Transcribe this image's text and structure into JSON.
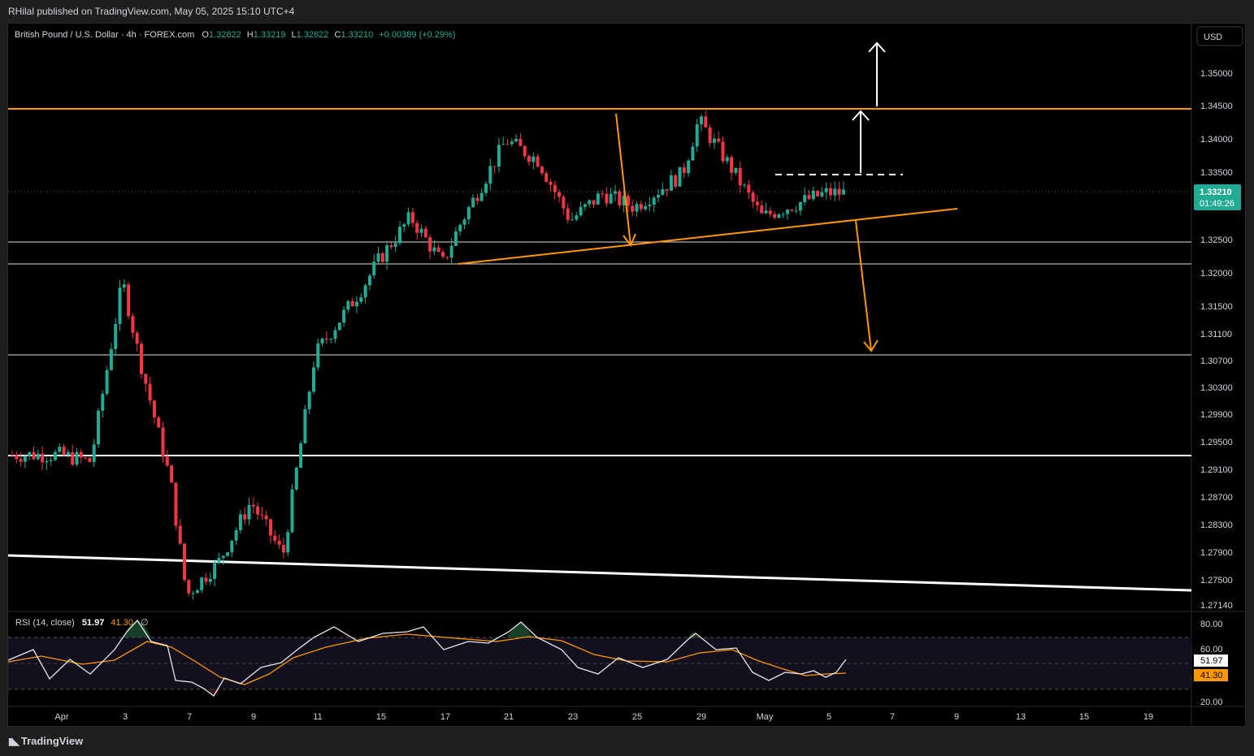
{
  "publisher": "RHilal published on TradingView.com, May 05, 2025 15:10 UTC+4",
  "footer_logo": "TradingView",
  "legend": {
    "symbol": "British Pound / U.S. Dollar · 4h · FOREX.com",
    "o_label": "O",
    "o": "1.32822",
    "h_label": "H",
    "h": "1.33219",
    "l_label": "L",
    "l": "1.32822",
    "c_label": "C",
    "c": "1.33210",
    "change": "+0.00389 (+0.29%)"
  },
  "currency_button": "USD",
  "price_badge": {
    "price": "1.33210",
    "countdown": "01:49:26"
  },
  "rsi": {
    "label": "RSI (14, close)",
    "value": "51.97",
    "ma": "41.30",
    "extra": "∅",
    "value_badge": "51.97",
    "ma_badge": "41.30"
  },
  "colors": {
    "up": "#22ab94",
    "down": "#f23645",
    "orange": "#ff9800",
    "white": "#ffffff",
    "badge": "#22ab94"
  },
  "chart_data": {
    "type": "candlestick",
    "symbol": "GBPUSD",
    "timeframe": "4h",
    "y_ticks": [
      "1.35000",
      "1.34500",
      "1.34000",
      "1.33500",
      "1.32500",
      "1.32000",
      "1.31500",
      "1.31100",
      "1.30700",
      "1.30300",
      "1.29900",
      "1.29500",
      "1.29100",
      "1.28700",
      "1.28300",
      "1.27900",
      "1.27500",
      "1.27140"
    ],
    "x_ticks": [
      "Apr",
      "3",
      "7",
      "9",
      "11",
      "15",
      "17",
      "21",
      "23",
      "25",
      "29",
      "May",
      "5",
      "7",
      "9",
      "13",
      "15",
      "19"
    ],
    "ylim": [
      1.2705,
      1.356
    ],
    "key_points": [
      {
        "date": "Apr 1",
        "close": 1.293
      },
      {
        "date": "Apr 2",
        "close": 1.292
      },
      {
        "date": "Apr 3",
        "close": 1.319
      },
      {
        "date": "Apr 4",
        "close": 1.308
      },
      {
        "date": "Apr 6",
        "close": 1.289
      },
      {
        "date": "Apr 7",
        "close": 1.272
      },
      {
        "date": "Apr 8",
        "close": 1.277
      },
      {
        "date": "Apr 9",
        "close": 1.286
      },
      {
        "date": "Apr 10",
        "close": 1.278
      },
      {
        "date": "Apr 11",
        "close": 1.308
      },
      {
        "date": "Apr 14",
        "close": 1.318
      },
      {
        "date": "Apr 15",
        "close": 1.322
      },
      {
        "date": "Apr 16",
        "close": 1.3285
      },
      {
        "date": "Apr 17",
        "close": 1.3215
      },
      {
        "date": "Apr 18",
        "close": 1.327
      },
      {
        "date": "Apr 21",
        "close": 1.34
      },
      {
        "date": "Apr 22",
        "close": 1.337
      },
      {
        "date": "Apr 23",
        "close": 1.328
      },
      {
        "date": "Apr 24",
        "close": 1.332
      },
      {
        "date": "Apr 25",
        "close": 1.33
      },
      {
        "date": "Apr 28",
        "close": 1.335
      },
      {
        "date": "Apr 29",
        "close": 1.343
      },
      {
        "date": "Apr 30",
        "close": 1.336
      },
      {
        "date": "May 1",
        "close": 1.3285
      },
      {
        "date": "May 2",
        "close": 1.3295
      },
      {
        "date": "May 5",
        "close": 1.3321
      }
    ],
    "horizontal_levels": [
      1.3445,
      1.325,
      1.3215,
      1.308,
      1.2934
    ],
    "rsi_ticks": [
      "80.00",
      "60.00",
      "20.00"
    ],
    "rsi_levels": [
      70,
      30
    ],
    "rsi_last": 51.97,
    "rsi_ma_last": 41.3
  }
}
